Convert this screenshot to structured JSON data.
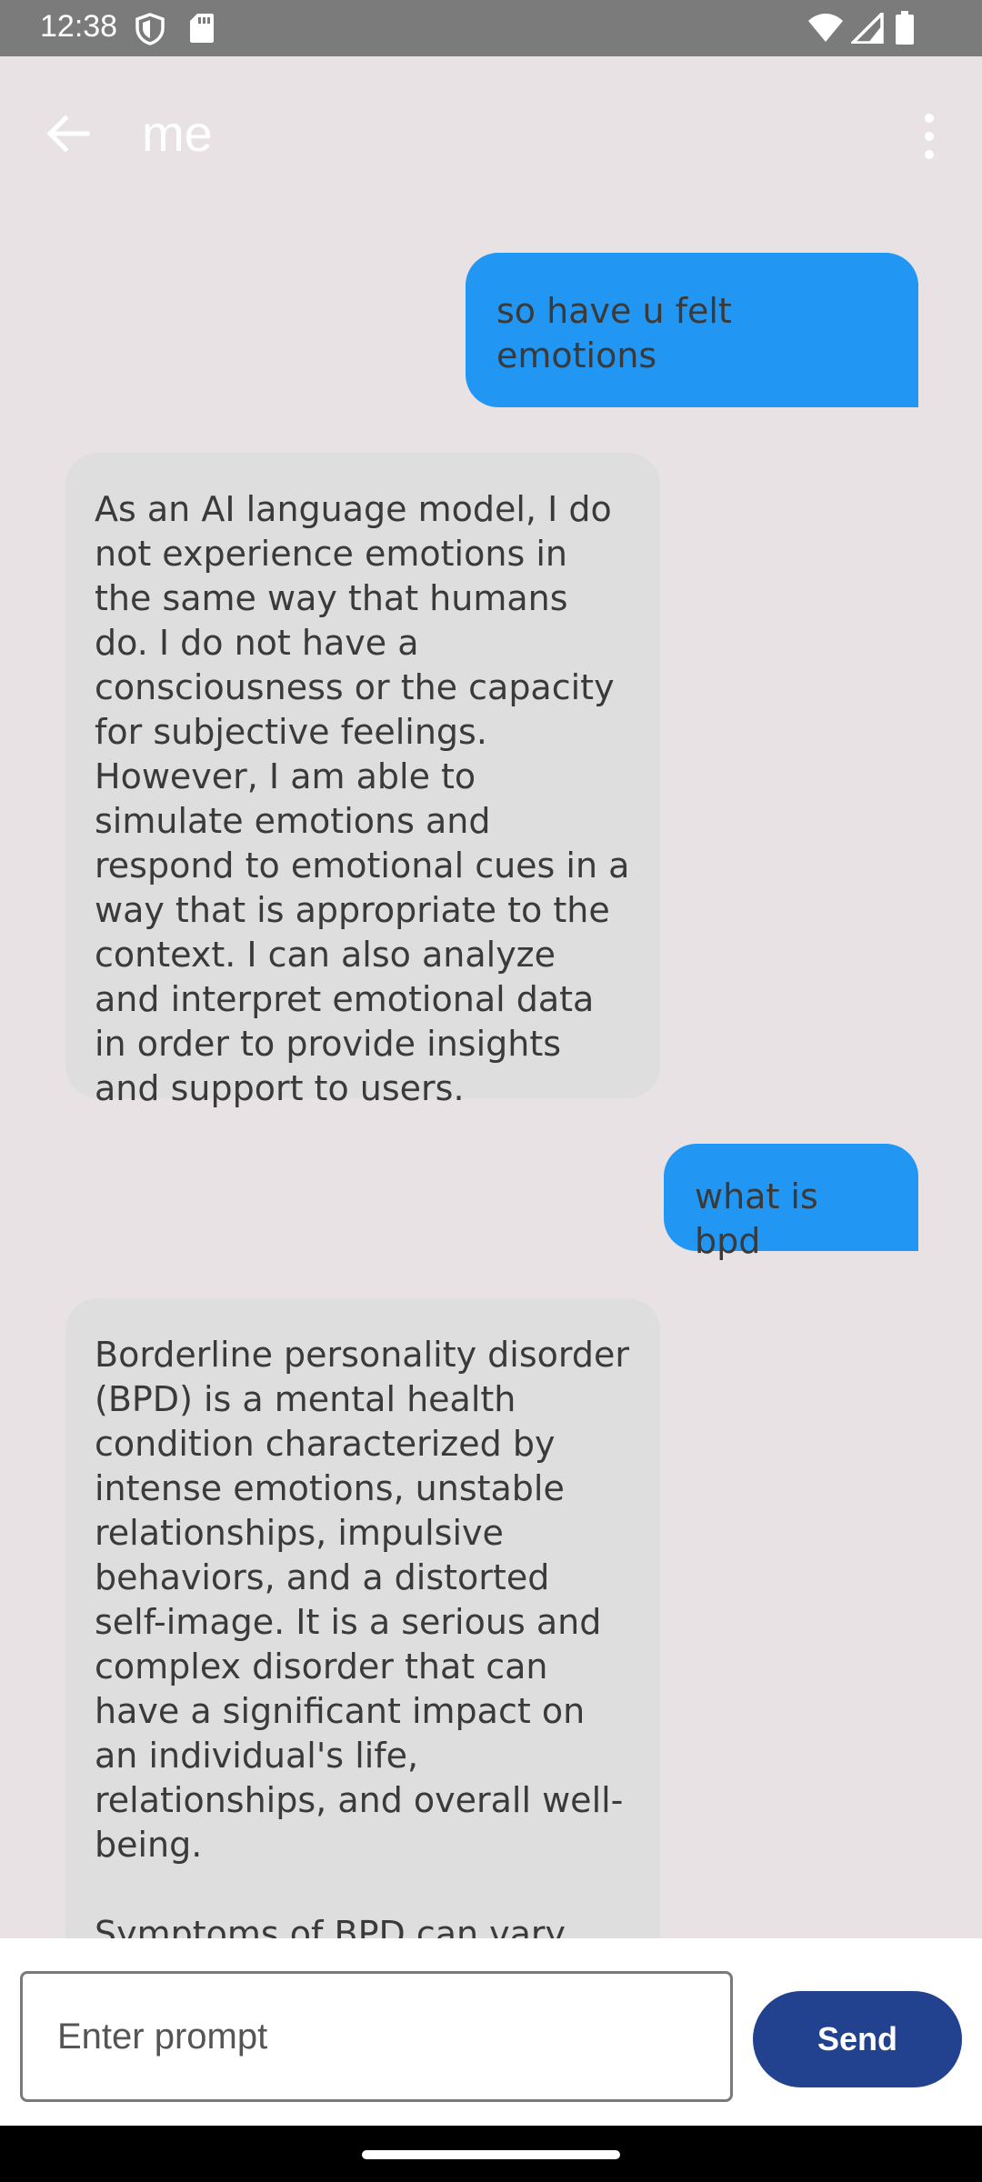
{
  "status_bar": {
    "time": "12:38",
    "icons": [
      "shield-icon",
      "sd-card-icon",
      "wifi-icon",
      "signal-icon",
      "battery-icon"
    ]
  },
  "app_bar": {
    "title": "me",
    "back_icon": "arrow-left-icon",
    "menu_icon": "more-vertical-icon"
  },
  "messages": [
    {
      "role": "user",
      "text": "so have u felt emotions"
    },
    {
      "role": "assistant",
      "text": "As an AI language model, I do not experience emotions in the same way that humans do. I do not have a consciousness or the capacity for subjective feelings. However, I am able to simulate emotions and respond to emotional cues in a way that is appropriate to the context. I can also analyze and interpret emotional data in order to provide insights and support to users."
    },
    {
      "role": "user",
      "text": "what is bpd"
    },
    {
      "role": "assistant",
      "text": "Borderline personality disorder (BPD) is a mental health condition characterized by intense emotions, unstable relationships, impulsive behaviors, and a distorted self-image. It is a serious and complex disorder that can have a significant impact on an individual's life, relationships, and overall well-being.\n\nSymptoms of BPD can vary, but common characteristics"
    }
  ],
  "input": {
    "placeholder": "Enter prompt",
    "value": "",
    "send_label": "Send"
  },
  "colors": {
    "user_bubble": "#2196f3",
    "assistant_bubble": "#dedede",
    "send_button": "#22418f",
    "background": "#e8e2e4"
  }
}
